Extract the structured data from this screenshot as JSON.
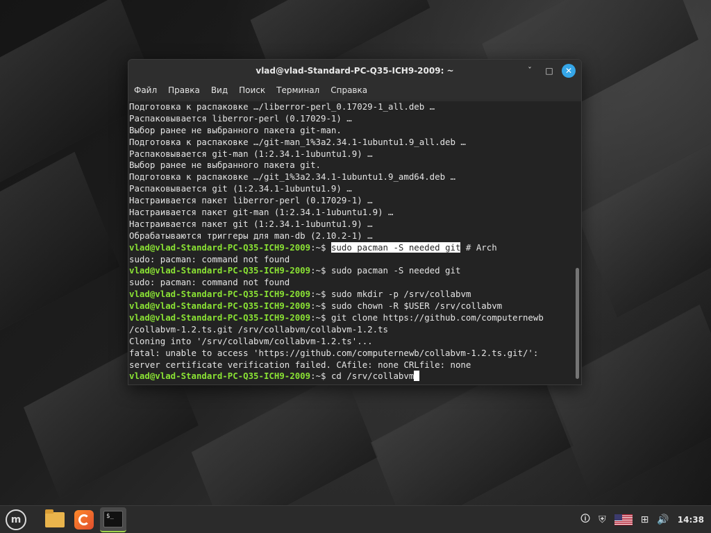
{
  "window": {
    "title": "vlad@vlad-Standard-PC-Q35-ICH9-2009: ~",
    "minimize": "ˇ",
    "maximize": "□",
    "close": "✕"
  },
  "menu": [
    "Файл",
    "Правка",
    "Вид",
    "Поиск",
    "Терминал",
    "Справка"
  ],
  "prompt": {
    "user": "vlad@vlad-Standard-PC-Q35-ICH9-2009",
    "sep": ":~$"
  },
  "lines": [
    {
      "type": "out",
      "text": "Подготовка к распаковке …/liberror-perl_0.17029-1_all.deb …"
    },
    {
      "type": "out",
      "text": "Распаковывается liberror-perl (0.17029-1) …"
    },
    {
      "type": "out",
      "text": "Выбор ранее не выбранного пакета git-man."
    },
    {
      "type": "out",
      "text": "Подготовка к распаковке …/git-man_1%3a2.34.1-1ubuntu1.9_all.deb …"
    },
    {
      "type": "out",
      "text": "Распаковывается git-man (1:2.34.1-1ubuntu1.9) …"
    },
    {
      "type": "out",
      "text": "Выбор ранее не выбранного пакета git."
    },
    {
      "type": "out",
      "text": "Подготовка к распаковке …/git_1%3a2.34.1-1ubuntu1.9_amd64.deb …"
    },
    {
      "type": "out",
      "text": "Распаковывается git (1:2.34.1-1ubuntu1.9) …"
    },
    {
      "type": "out",
      "text": "Настраивается пакет liberror-perl (0.17029-1) …"
    },
    {
      "type": "out",
      "text": "Настраивается пакет git-man (1:2.34.1-1ubuntu1.9) …"
    },
    {
      "type": "out",
      "text": "Настраивается пакет git (1:2.34.1-1ubuntu1.9) …"
    },
    {
      "type": "out",
      "text": "Обрабатываются триггеры для man-db (2.10.2-1) …"
    },
    {
      "type": "cmd",
      "text": " ",
      "selected": "sudo pacman -S needed git",
      "after": " # Arch"
    },
    {
      "type": "out",
      "text": "sudo: pacman: command not found"
    },
    {
      "type": "cmd",
      "text": " sudo pacman -S needed git"
    },
    {
      "type": "out",
      "text": "sudo: pacman: command not found"
    },
    {
      "type": "cmd",
      "text": " sudo mkdir -p /srv/collabvm"
    },
    {
      "type": "cmd",
      "text": " sudo chown -R $USER /srv/collabvm"
    },
    {
      "type": "cmd",
      "text": " git clone https://github.com/computernewb"
    },
    {
      "type": "out",
      "text": "/collabvm-1.2.ts.git /srv/collabvm/collabvm-1.2.ts"
    },
    {
      "type": "out",
      "text": "Cloning into '/srv/collabvm/collabvm-1.2.ts'..."
    },
    {
      "type": "out",
      "text": "fatal: unable to access 'https://github.com/computernewb/collabvm-1.2.ts.git/':"
    },
    {
      "type": "out",
      "text": "server certificate verification failed. CAfile: none CRLfile: none"
    },
    {
      "type": "cmd",
      "text": " cd /srv/collabvm",
      "cursor": true
    }
  ],
  "taskbar": {
    "apps": [
      "mint-menu-icon",
      "folder-icon",
      "firefox-icon",
      "terminal-icon"
    ],
    "terminal_glyph": "$_",
    "mint_glyph": "m",
    "clock": "14:38",
    "tray": [
      "notification-icon",
      "shield-icon",
      "us-flag-icon",
      "network-icon",
      "volume-icon"
    ]
  },
  "colors": {
    "prompt": "#8ae234",
    "terminal_bg": "#232323",
    "accent": "#35a6e8"
  }
}
